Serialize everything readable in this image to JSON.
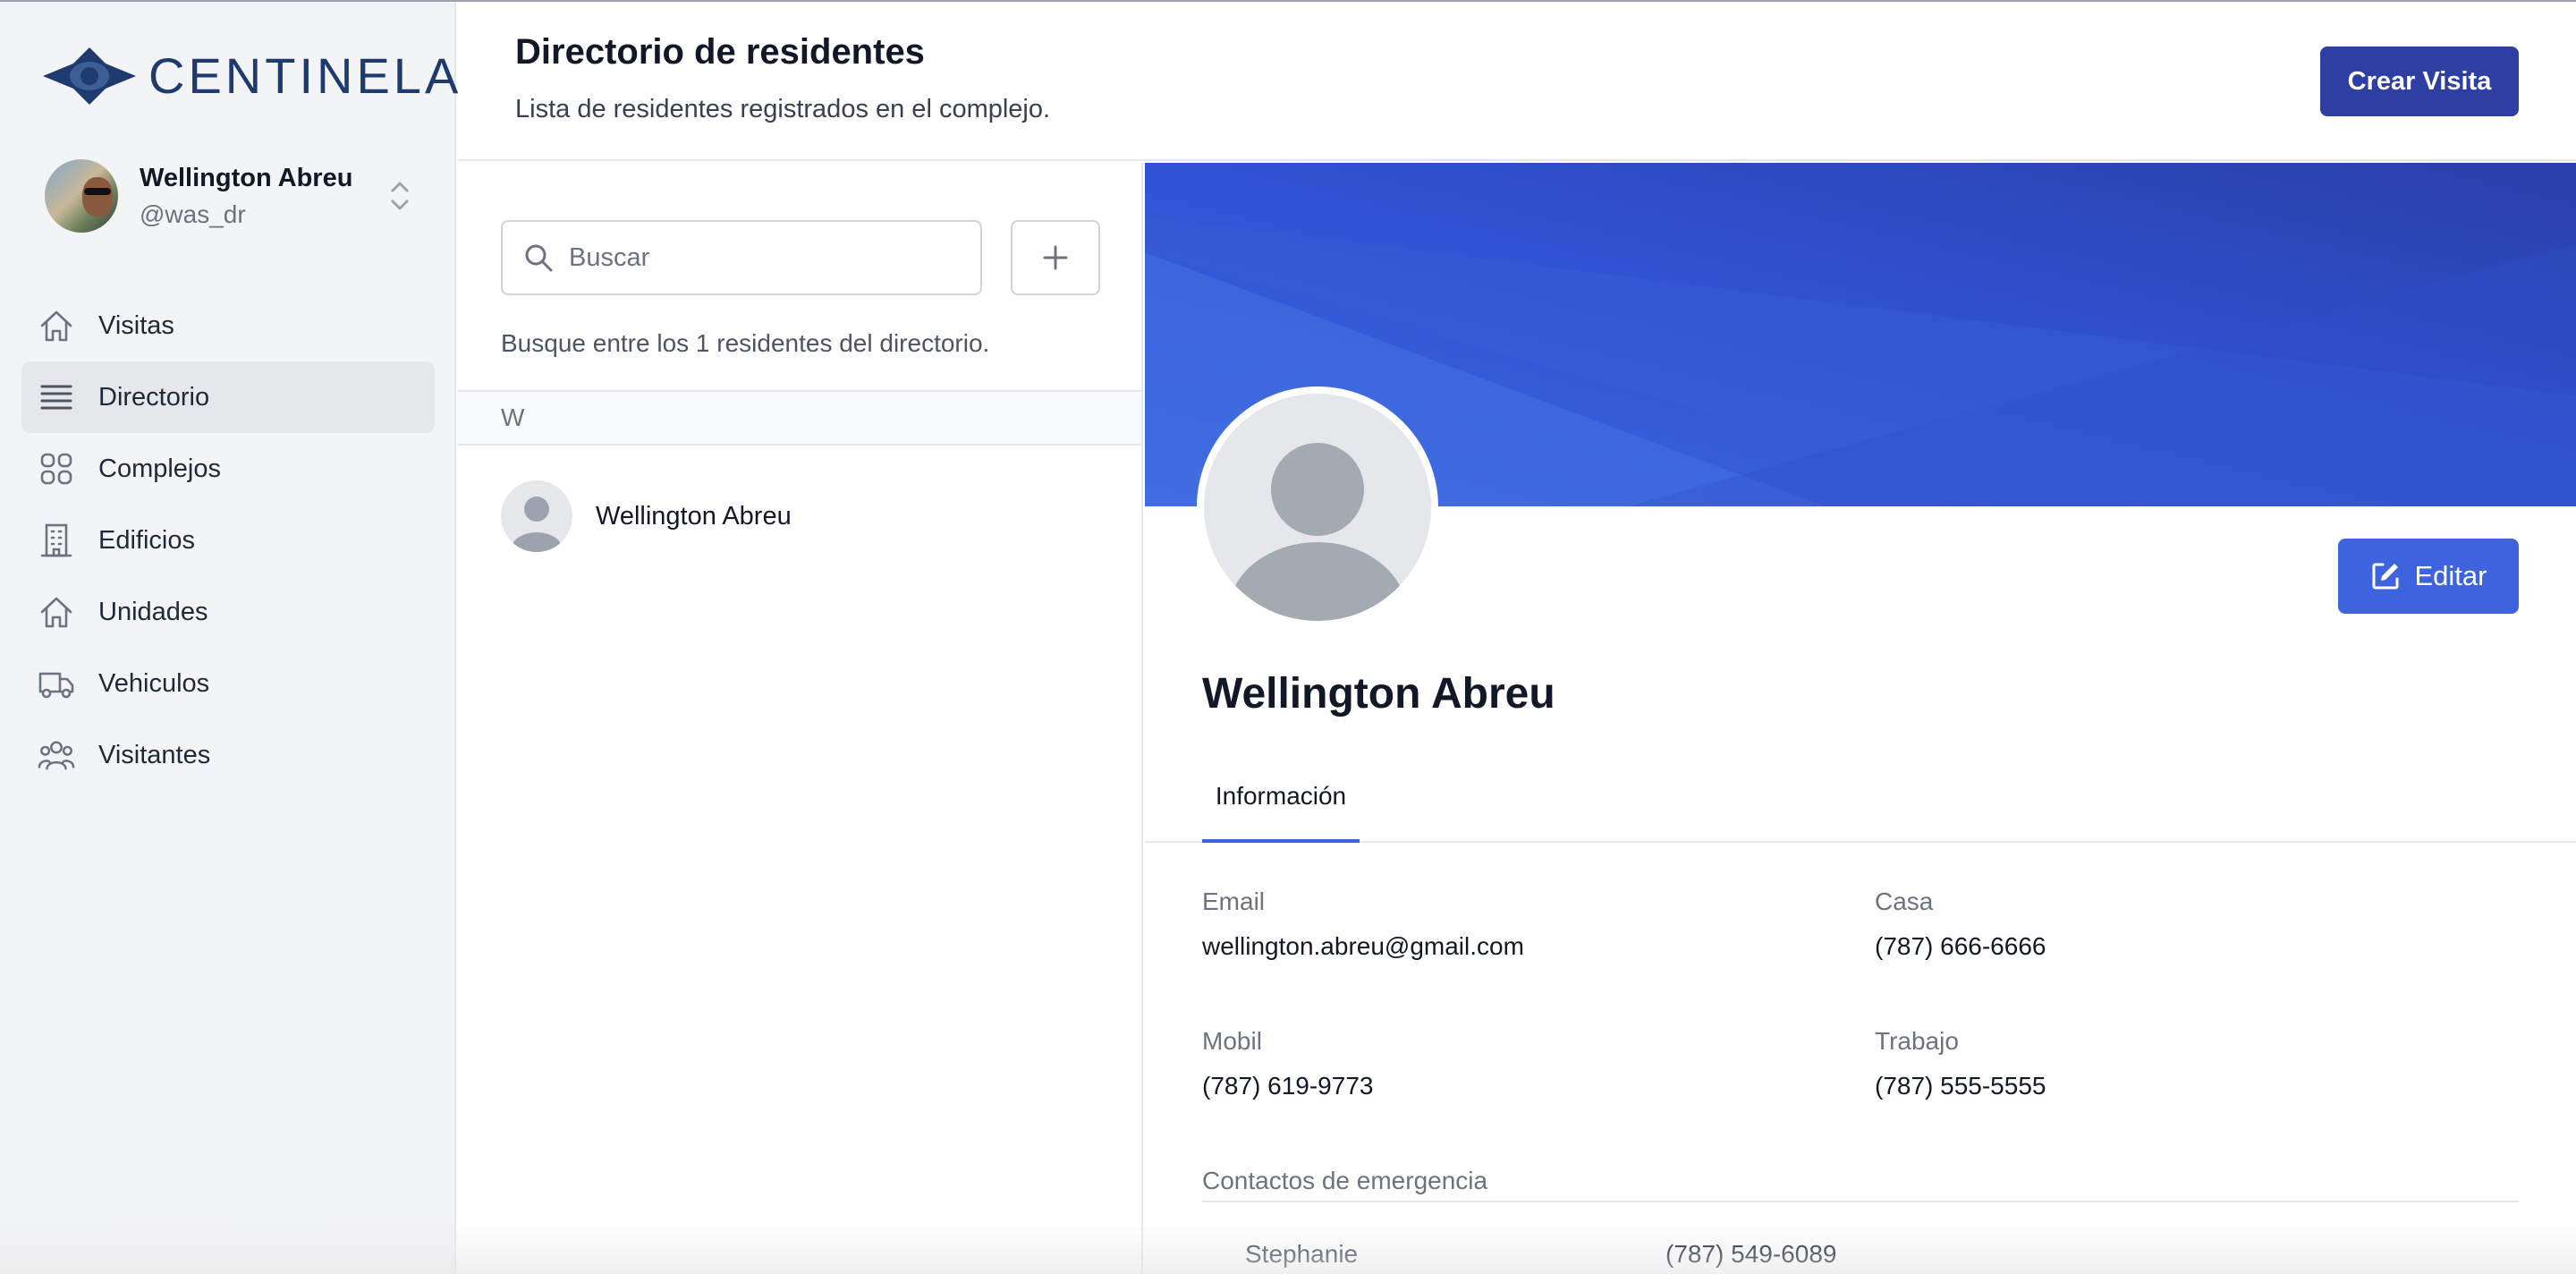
{
  "app": {
    "brand": "CENTINELA"
  },
  "user": {
    "name": "Wellington Abreu",
    "handle": "@was_dr"
  },
  "sidebar": {
    "items": [
      {
        "label": "Visitas",
        "icon": "home-icon"
      },
      {
        "label": "Directorio",
        "icon": "list-icon",
        "active": true
      },
      {
        "label": "Complejos",
        "icon": "grid-icon"
      },
      {
        "label": "Edificios",
        "icon": "building-icon"
      },
      {
        "label": "Unidades",
        "icon": "home-icon"
      },
      {
        "label": "Vehiculos",
        "icon": "truck-icon"
      },
      {
        "label": "Visitantes",
        "icon": "users-icon"
      }
    ]
  },
  "header": {
    "title": "Directorio de residentes",
    "subtitle": "Lista de residentes registrados en el complejo.",
    "create_button": "Crear Visita"
  },
  "directory": {
    "search_placeholder": "Buscar",
    "count_text": "Busque entre los 1 residentes del directorio.",
    "groups": [
      {
        "letter": "W",
        "residents": [
          {
            "name": "Wellington Abreu"
          }
        ]
      }
    ]
  },
  "profile": {
    "name": "Wellington Abreu",
    "edit_button": "Editar",
    "tabs": [
      {
        "label": "Información",
        "active": true
      }
    ],
    "fields": {
      "email": {
        "label": "Email",
        "value": "wellington.abreu@gmail.com"
      },
      "casa": {
        "label": "Casa",
        "value": "(787) 666-6666"
      },
      "mobil": {
        "label": "Mobil",
        "value": "(787) 619-9773"
      },
      "trabajo": {
        "label": "Trabajo",
        "value": "(787) 555-5555"
      }
    },
    "emergency": {
      "title": "Contactos de emergencia",
      "contacts": [
        {
          "name": "Stephanie",
          "phone": "(787) 549-6089"
        }
      ]
    }
  },
  "colors": {
    "brand": "#1e3a6e",
    "primary": "#2e3fa3",
    "edit": "#3d63dd",
    "banner": "#3258d8",
    "sidebar_bg": "#f3f4f6"
  }
}
